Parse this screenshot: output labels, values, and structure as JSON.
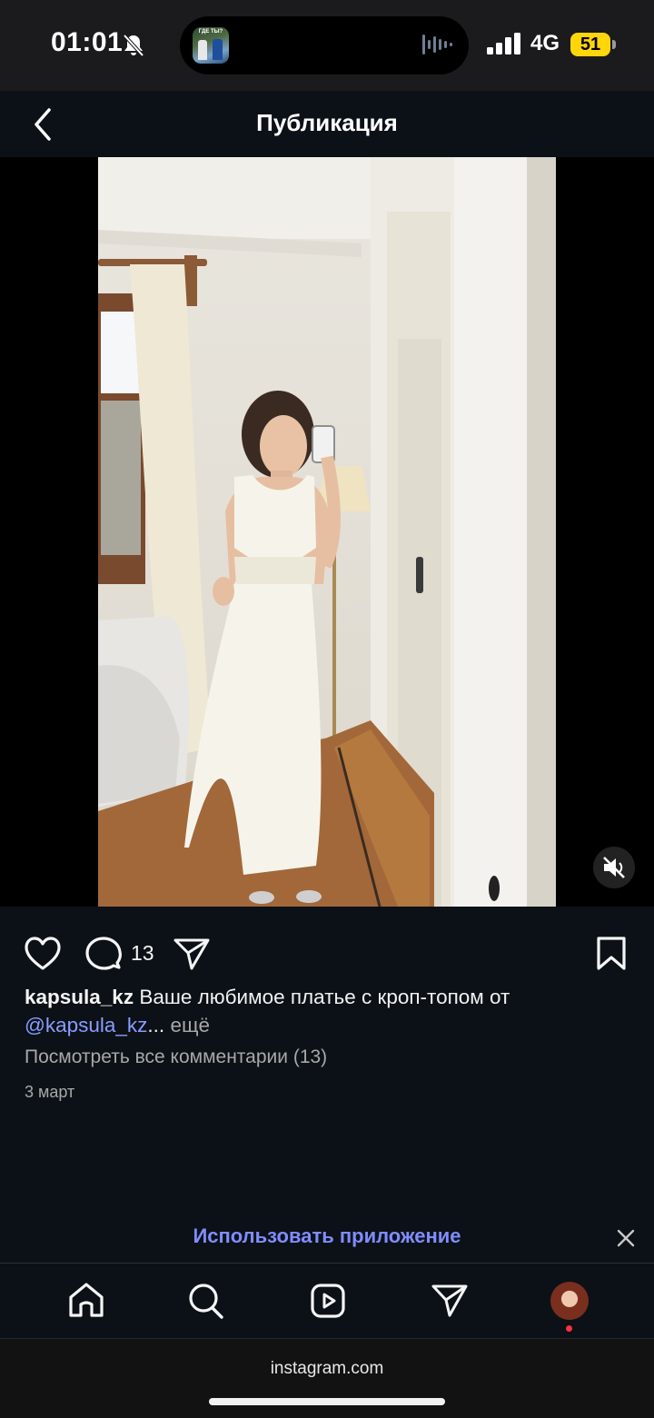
{
  "status_bar": {
    "time": "01:01",
    "island_thumb_text": "ГДЕ ТЫ?",
    "network": "4G",
    "battery": "51"
  },
  "header": {
    "title": "Публикация"
  },
  "post": {
    "comment_count": "13",
    "caption_user": "kapsula_kz",
    "caption_text": " Ваше любимое платье с кроп-топом от ",
    "caption_mention": "@kapsula_kz",
    "caption_ellipsis": "...",
    "caption_more": " ещё",
    "view_comments": "Посмотреть все комментарии (13)",
    "date": "3 март"
  },
  "banner": {
    "open_app": "Использовать приложение"
  },
  "browser": {
    "url": "instagram.com"
  },
  "colors": {
    "background": "#0c1117",
    "link": "#7f8dff",
    "mention": "#8a9cff",
    "secondary_text": "#a8a8a8",
    "battery": "#ffd60a",
    "notification_dot": "#ff3040"
  },
  "icons": [
    "mute-bell-icon",
    "sound-wave-icon",
    "signal-icon",
    "back-chevron-icon",
    "muted-speaker-icon",
    "heart-icon",
    "comment-icon",
    "share-icon",
    "bookmark-icon",
    "close-icon",
    "home-icon",
    "search-icon",
    "reels-icon",
    "direct-icon"
  ]
}
